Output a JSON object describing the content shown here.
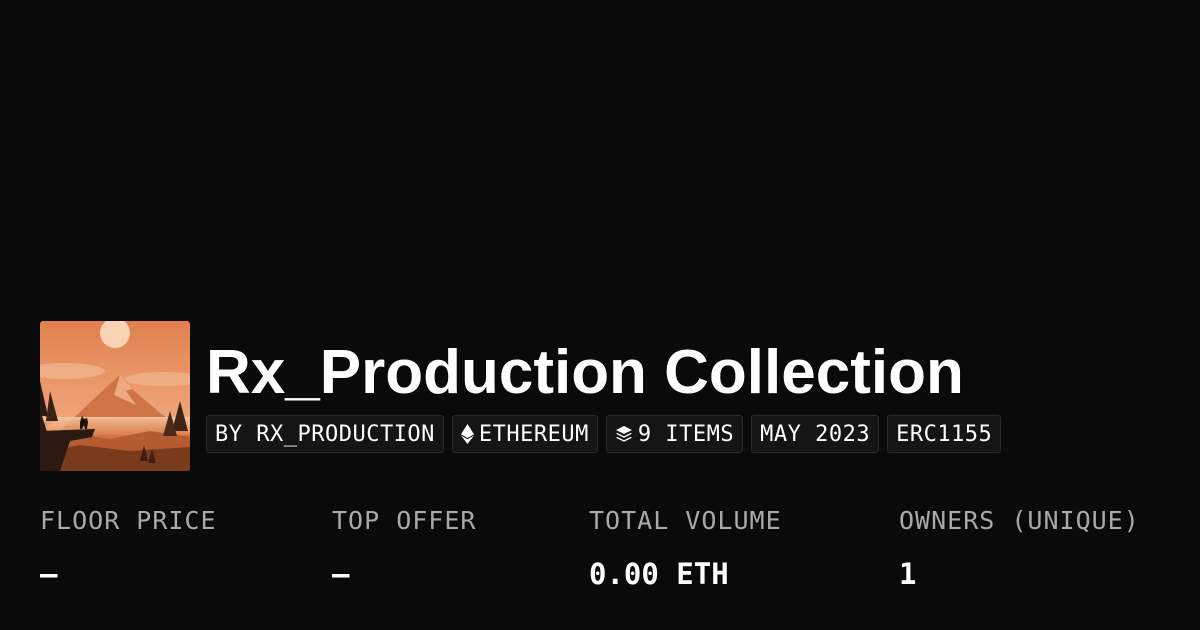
{
  "collection": {
    "title": "Rx_Production Collection",
    "avatar_icon": "mountain-landscape-wolf-image"
  },
  "tags": [
    {
      "label": "BY RX_PRODUCTION",
      "icon": null
    },
    {
      "label": "ETHEREUM",
      "icon": "ethereum-icon"
    },
    {
      "label": "9 ITEMS",
      "icon": "layers-icon"
    },
    {
      "label": "MAY 2023",
      "icon": null
    },
    {
      "label": "ERC1155",
      "icon": null
    }
  ],
  "stats": [
    {
      "label": "FLOOR PRICE",
      "value": "–"
    },
    {
      "label": "TOP OFFER",
      "value": "–"
    },
    {
      "label": "TOTAL VOLUME",
      "value": "0.00 ETH"
    },
    {
      "label": "OWNERS (UNIQUE)",
      "value": "1"
    }
  ],
  "colors": {
    "background": "#0a0a0a",
    "tag_background": "#151515",
    "tag_border": "#2a2a2a",
    "label_gray": "#a9a9a9",
    "text": "#ffffff"
  }
}
